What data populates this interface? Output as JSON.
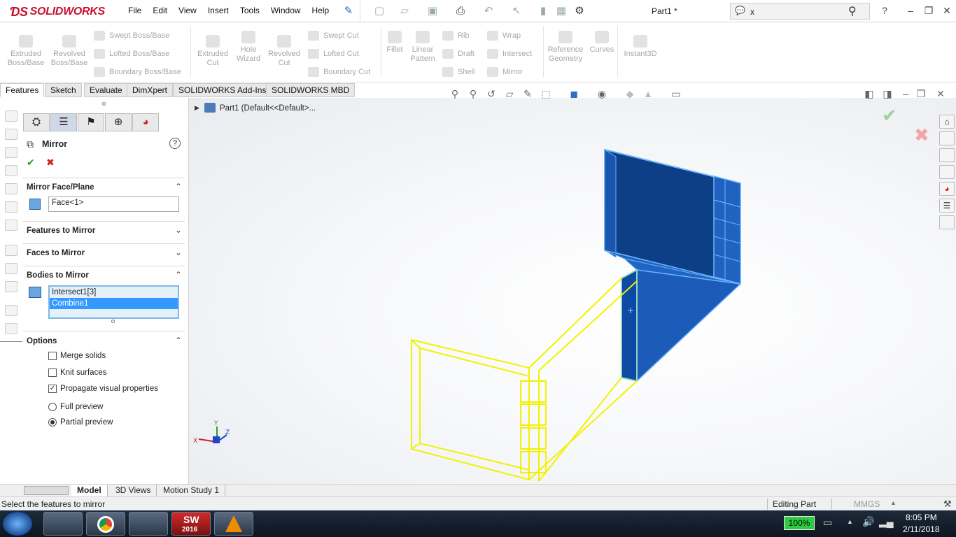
{
  "app": {
    "brand": "SOLIDWORKS",
    "doc_title": "Part1 *"
  },
  "menus": [
    "File",
    "Edit",
    "View",
    "Insert",
    "Tools",
    "Window",
    "Help"
  ],
  "search": {
    "value": "x"
  },
  "help_label": "?",
  "command_manager": {
    "extruded_boss": "Extruded\nBoss/Base",
    "revolved_boss": "Revolved\nBoss/Base",
    "swept_boss": "Swept Boss/Base",
    "lofted_boss": "Lofted Boss/Base",
    "boundary_boss": "Boundary Boss/Base",
    "extruded_cut": "Extruded\nCut",
    "hole_wizard": "Hole\nWizard",
    "revolved_cut": "Revolved\nCut",
    "swept_cut": "Swept Cut",
    "lofted_cut": "Lofted Cut",
    "boundary_cut": "Boundary Cut",
    "fillet": "Fillet",
    "linear_pattern": "Linear\nPattern",
    "rib": "Rib",
    "draft": "Draft",
    "shell": "Shell",
    "wrap": "Wrap",
    "intersect": "Intersect",
    "mirror": "Mirror",
    "reference_geometry": "Reference\nGeometry",
    "curves": "Curves",
    "instant3d": "Instant3D"
  },
  "tabs": [
    "Features",
    "Sketch",
    "Evaluate",
    "DimXpert",
    "SOLIDWORKS Add-Ins",
    "SOLIDWORKS MBD"
  ],
  "tree": {
    "root": "Part1  (Default<<Default>..."
  },
  "property_manager": {
    "title": "Mirror",
    "mirror_face_plane": {
      "label": "Mirror Face/Plane",
      "value": "Face<1>"
    },
    "features_to_mirror": "Features to Mirror",
    "faces_to_mirror": "Faces to Mirror",
    "bodies_to_mirror": {
      "label": "Bodies to Mirror",
      "items": [
        "Intersect1[3]",
        "Combine1"
      ],
      "selected": 1
    },
    "options": {
      "label": "Options",
      "merge_solids": {
        "label": "Merge solids",
        "checked": false
      },
      "knit_surfaces": {
        "label": "Knit surfaces",
        "checked": false
      },
      "propagate": {
        "label": "Propagate visual properties",
        "checked": true
      },
      "full_preview": {
        "label": "Full preview",
        "selected": false
      },
      "partial_preview": {
        "label": "Partial preview",
        "selected": true
      }
    }
  },
  "triad": {
    "x": "X",
    "y": "Y",
    "z": "Z"
  },
  "bottom_tabs": [
    "Model",
    "3D Views",
    "Motion Study 1"
  ],
  "status": {
    "message": "Select the features to mirror",
    "mode": "Editing Part",
    "units": "MMGS"
  },
  "taskbar": {
    "battery": "100%",
    "time": "8:05 PM",
    "date": "2/11/2018",
    "sw_badge": "2016"
  },
  "colors": {
    "body_blue": "#1f6fd1",
    "preview_yellow": "#f2f200",
    "accent_red": "#c8102e"
  }
}
